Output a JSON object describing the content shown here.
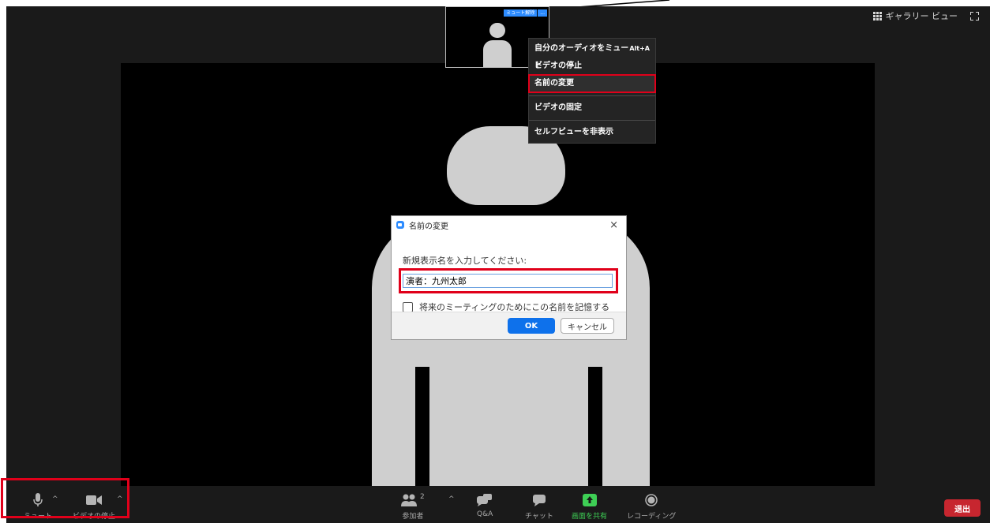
{
  "top_bar": {
    "gallery_view_label": "ギャラリー ビュー"
  },
  "self_tile": {
    "unmute_label": "ミュート解除",
    "more_label": "..."
  },
  "context_menu": {
    "items": [
      {
        "label": "自分のオーディオをミュート",
        "shortcut": "Alt+A"
      },
      {
        "label": "ビデオの停止"
      },
      {
        "label": "名前の変更"
      },
      {
        "label": "ビデオの固定"
      },
      {
        "label": "セルフビューを非表示"
      }
    ]
  },
  "rename_dialog": {
    "title": "名前の変更",
    "close_label": "×",
    "prompt": "新規表示名を入力してください:",
    "name_value": "演者：九州太郎",
    "remember_label": "将来のミーティングのためにこの名前を記憶する",
    "ok_label": "OK",
    "cancel_label": "キャンセル"
  },
  "toolbar": {
    "mute_label": "ミュート",
    "stop_video_label": "ビデオの停止",
    "participants_label": "参加者",
    "participants_count": "2",
    "qa_label": "Q&A",
    "chat_label": "チャット",
    "share_label": "画面を共有",
    "record_label": "レコーディング",
    "leave_label": "退出",
    "caret": "^"
  },
  "colors": {
    "share_green": "#3ecf55",
    "leave_red": "#c7262f",
    "highlight_red": "#e0001a",
    "zoom_blue": "#0e71eb"
  }
}
